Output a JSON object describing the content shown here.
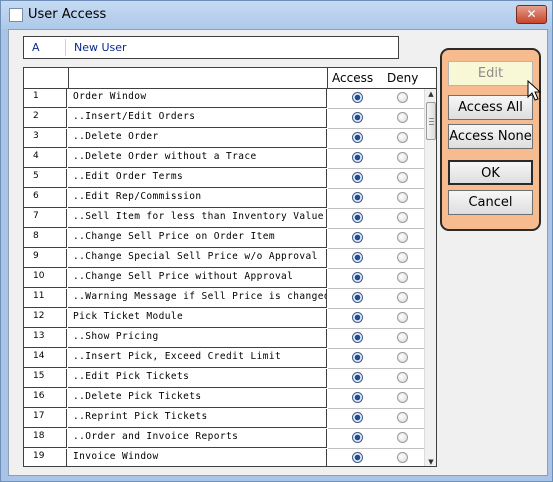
{
  "window": {
    "title": "User Access",
    "close_glyph": "✕"
  },
  "user": {
    "code": "A",
    "name": "New User"
  },
  "grid": {
    "headers": {
      "access": "Access",
      "deny": "Deny"
    },
    "rows": [
      {
        "num": "1",
        "label": "Order Window",
        "selected": "access"
      },
      {
        "num": "2",
        "label": "..Insert/Edit Orders",
        "selected": "access"
      },
      {
        "num": "3",
        "label": "..Delete Order",
        "selected": "access"
      },
      {
        "num": "4",
        "label": "..Delete Order without a Trace",
        "selected": "access"
      },
      {
        "num": "5",
        "label": "..Edit Order Terms",
        "selected": "access"
      },
      {
        "num": "6",
        "label": "..Edit Rep/Commission",
        "selected": "access"
      },
      {
        "num": "7",
        "label": "..Sell Item for less than Inventory Value",
        "selected": "access"
      },
      {
        "num": "8",
        "label": "..Change Sell Price on Order Item",
        "selected": "access"
      },
      {
        "num": "9",
        "label": "..Change Special Sell Price w/o Approval",
        "selected": "access"
      },
      {
        "num": "10",
        "label": "..Change Sell Price without Approval",
        "selected": "access"
      },
      {
        "num": "11",
        "label": "..Warning Message if Sell Price is changed",
        "selected": "access"
      },
      {
        "num": "12",
        "label": "Pick Ticket Module",
        "selected": "access"
      },
      {
        "num": "13",
        "label": "..Show Pricing",
        "selected": "access"
      },
      {
        "num": "14",
        "label": "..Insert Pick, Exceed Credit Limit",
        "selected": "access"
      },
      {
        "num": "15",
        "label": "..Edit Pick Tickets",
        "selected": "access"
      },
      {
        "num": "16",
        "label": "..Delete Pick Tickets",
        "selected": "access"
      },
      {
        "num": "17",
        "label": "..Reprint Pick Tickets",
        "selected": "access"
      },
      {
        "num": "18",
        "label": "..Order and Invoice Reports",
        "selected": "access"
      },
      {
        "num": "19",
        "label": "Invoice Window",
        "selected": "access"
      }
    ]
  },
  "actions": {
    "edit": "Edit",
    "access_all": "Access All",
    "access_none": "Access None",
    "ok": "OK",
    "cancel": "Cancel"
  },
  "scroll": {
    "up_glyph": "▲",
    "down_glyph": "▼"
  },
  "colors": {
    "panel_bg": "#f6bb8e",
    "selected_radio": "#1e4f9c"
  }
}
